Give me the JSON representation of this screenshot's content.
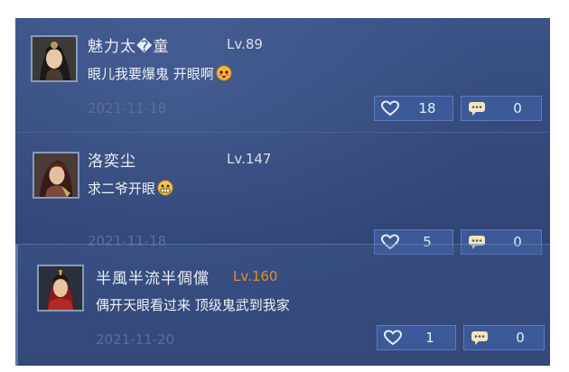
{
  "comments": [
    {
      "name": "魅力太�童",
      "level": "Lv.89",
      "message": "眼儿我要爆鬼 开眼啊",
      "date": "2021-11-18",
      "likes": "18",
      "replies": "0",
      "emoji": "flushed-face-emoji"
    },
    {
      "name": "洛奕尘",
      "level": "Lv.147",
      "message": "求二爷开眼",
      "date": "2021-11-18",
      "likes": "5",
      "replies": "0",
      "emoji": "grimace-face-emoji"
    },
    {
      "name": "半風半流半倜儻",
      "level": "Lv.160",
      "message": "偶开天眼看过来 顶级鬼武到我家",
      "date": "2021-11-20",
      "likes": "1",
      "replies": "0",
      "emoji": ""
    }
  ],
  "icons": {
    "like": "heart-icon",
    "reply": "speech-bubble-icon"
  },
  "colors": {
    "panel_bg": "#34497a",
    "button_bg": "#3d5a98",
    "level_highlight": "#e48a2a",
    "date_text": "#5c6d96"
  }
}
